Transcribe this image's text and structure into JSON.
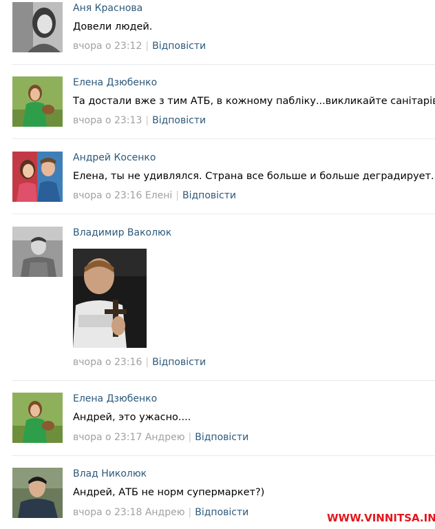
{
  "comments": [
    {
      "author": "Аня Краснова",
      "text": "Довели людей.",
      "time": "вчора о 23:12",
      "reply_to": "",
      "reply_label": "Відповісти"
    },
    {
      "author": "Елена Дзюбенко",
      "text": "Та достали вже з тим АТБ, в кожному пабліку...викликайте санітарів",
      "time": "вчора о 23:13",
      "reply_to": "",
      "reply_label": "Відповісти"
    },
    {
      "author": "Андрей Косенко",
      "text": "Елена, ты не удивлялся. Страна все больше и больше деградирует...",
      "time": "вчора о 23:16",
      "reply_to": "Елені",
      "reply_label": "Відповісти"
    },
    {
      "author": "Владимир Ваколюк",
      "text": "",
      "time": "вчора о 23:16",
      "reply_to": "",
      "reply_label": "Відповісти"
    },
    {
      "author": "Елена Дзюбенко",
      "text": "Андрей, это ужасно....",
      "time": "вчора о 23:17",
      "reply_to": "Андрею",
      "reply_label": "Відповісти"
    },
    {
      "author": "Влад Николюк",
      "text": "Андрей, АТБ не норм супермаркет?)",
      "time": "вчора о 23:18",
      "reply_to": "Андрею",
      "reply_label": "Відповісти"
    }
  ],
  "watermark": "WWW.VINNITSA.INFO",
  "colors": {
    "link": "#2b587a",
    "meta": "#a0a0a0",
    "divider": "#e6e9ed",
    "watermark": "#e4151c"
  }
}
